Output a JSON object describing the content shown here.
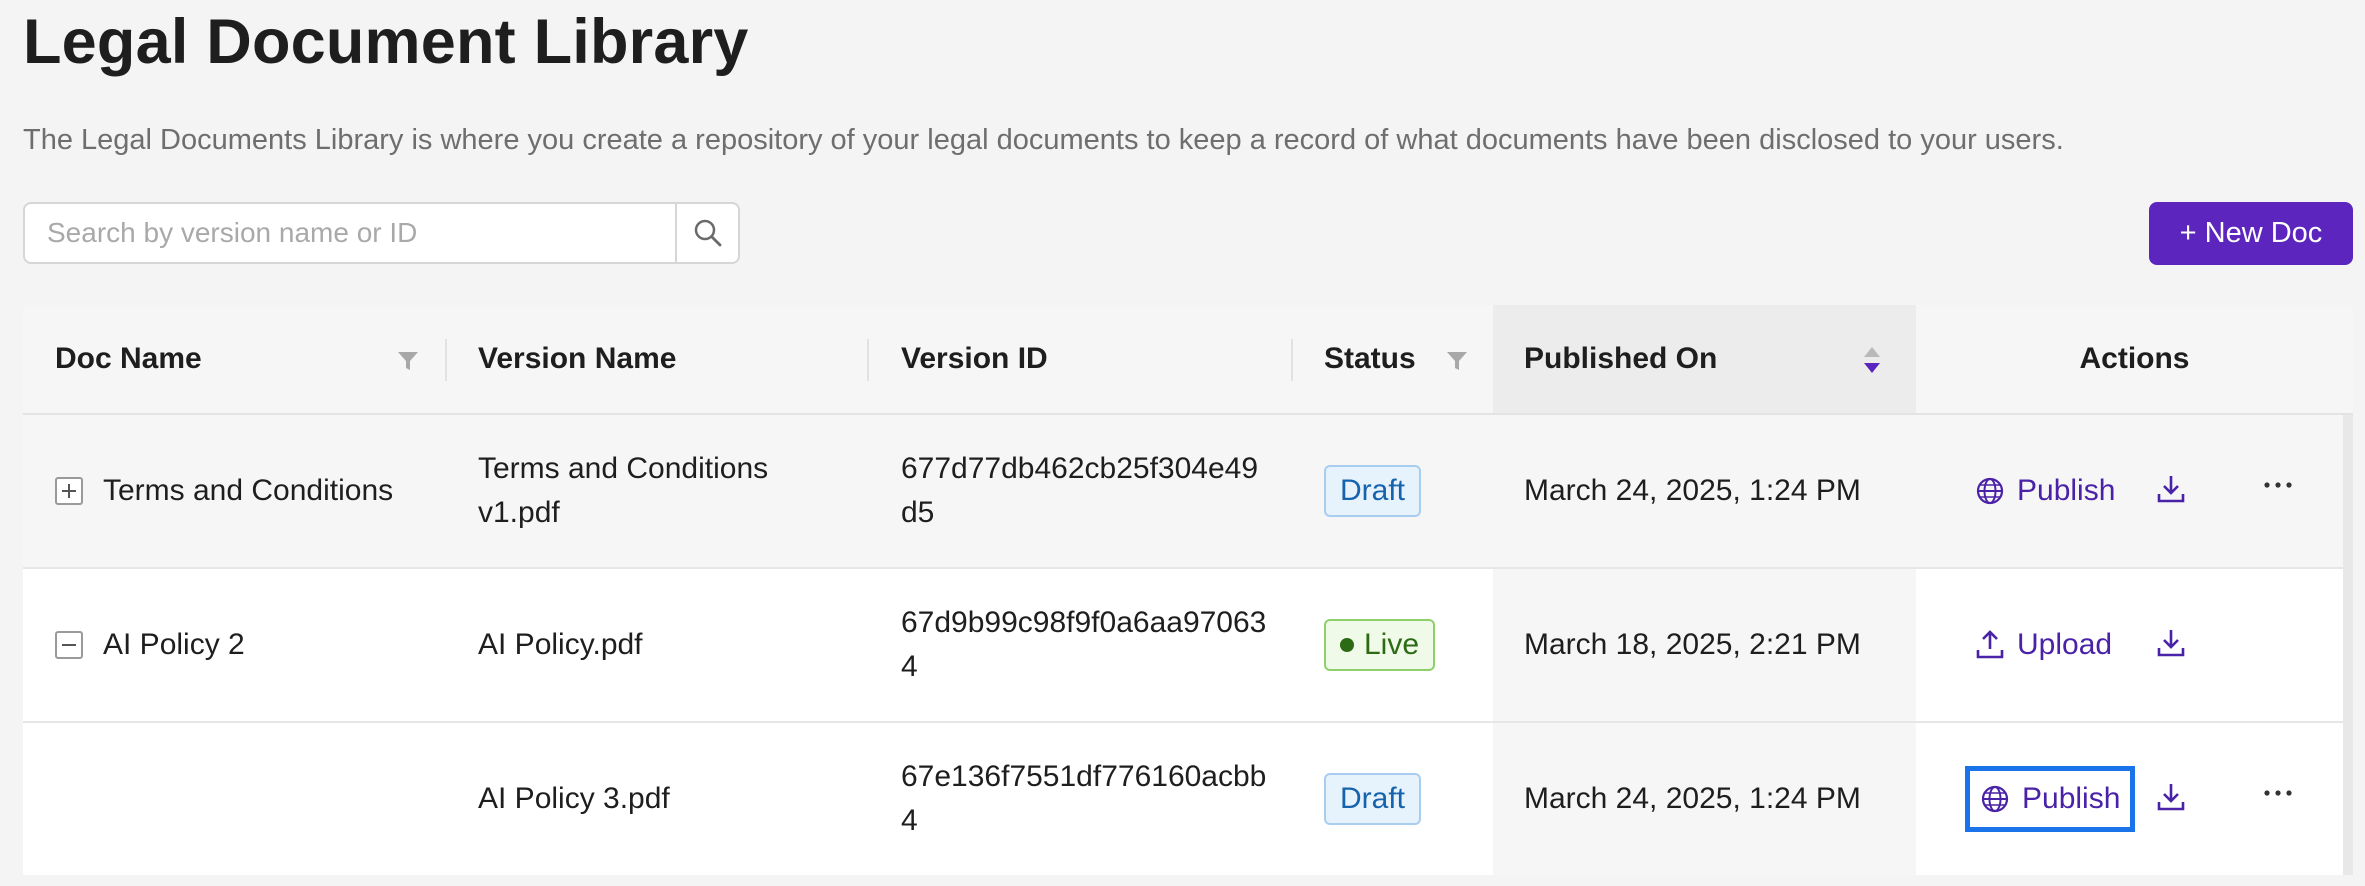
{
  "page": {
    "title": "Legal Document Library",
    "description": "The Legal Documents Library is where you create a repository of your legal documents to keep a record of what documents have been disclosed to your users."
  },
  "search": {
    "placeholder": "Search by version name or ID",
    "value": ""
  },
  "new_doc_label": "+ New Doc",
  "table": {
    "columns": {
      "doc_name": "Doc Name",
      "version_name": "Version Name",
      "version_id": "Version ID",
      "status": "Status",
      "published_on": "Published On",
      "actions": "Actions"
    },
    "rows": [
      {
        "expander": "plus",
        "doc_name": "Terms and Conditions",
        "version_name_line1": "Terms and Conditions",
        "version_name_line2": "v1.pdf",
        "version_id_line1": "677d77db462cb25f304e49",
        "version_id_line2": "d5",
        "status": "Draft",
        "published_on": "March 24, 2025, 1:24 PM",
        "primary_action": "Publish"
      },
      {
        "expander": "minus",
        "doc_name": "AI Policy 2",
        "version_name_line1": "AI Policy.pdf",
        "version_name_line2": "",
        "version_id_line1": "67d9b99c98f9f0a6aa97063",
        "version_id_line2": "4",
        "status": "Live",
        "published_on": "March 18, 2025, 2:21 PM",
        "primary_action": "Upload"
      },
      {
        "expander": "",
        "doc_name": "",
        "version_name_line1": "AI Policy 3.pdf",
        "version_name_line2": "",
        "version_id_line1": "67e136f7551df776160acbb",
        "version_id_line2": "4",
        "status": "Draft",
        "published_on": "March 24, 2025, 1:24 PM",
        "primary_action": "Publish"
      }
    ]
  },
  "colors": {
    "accent": "#5b25be",
    "link": "#4a22a8",
    "focus": "#1a73e8",
    "draft": "#1663ad",
    "live": "#2c6b14"
  },
  "icons": [
    "search-icon",
    "filter-icon",
    "sort-icon",
    "globe-icon",
    "upload-icon",
    "download-icon",
    "more-icon",
    "plus-icon",
    "minus-icon"
  ]
}
